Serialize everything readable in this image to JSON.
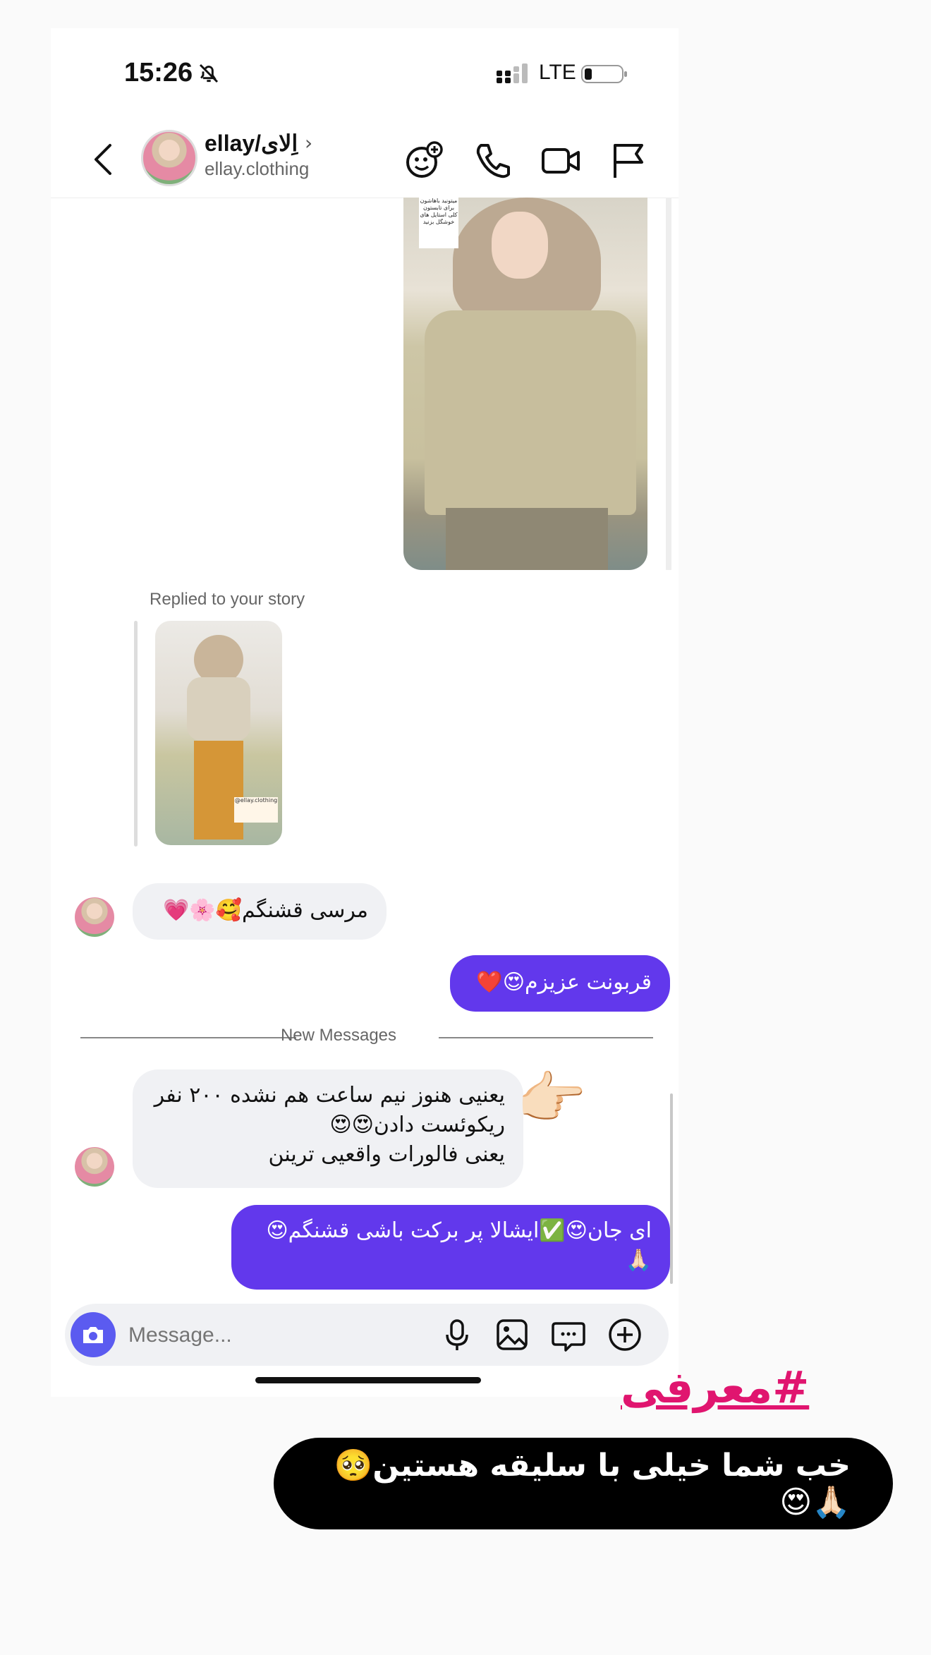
{
  "status_bar": {
    "time": "15:26",
    "network": "LTE"
  },
  "header": {
    "name": "ellay/اِلای",
    "username": "ellay.clothing"
  },
  "story_tag": "میتونید باهاشون برای تابستون کلی استایل های خوشگل بزنید",
  "replied_label": "Replied to your story",
  "thumb_label": "@ellay.clothing",
  "messages": [
    {
      "dir": "in",
      "text": "مرسی قشنگم🥰🌸💗"
    },
    {
      "dir": "out",
      "text": "قربونت عزیزم😍❤️"
    }
  ],
  "new_messages_label": "New Messages",
  "new_in_lines": [
    "یعنیی هنوز نیم ساعت هم نشده ۲۰۰ نفر",
    "ریکوئست دادن😍😍",
    "یعنی فالورات واقعیی ترینن"
  ],
  "pointing_emoji": "👉🏻",
  "out_long_lines": [
    "ای جان😍✅ایشالا پر برکت باشی قشنگم😍",
    "🙏🏻"
  ],
  "composer": {
    "placeholder": "Message..."
  },
  "overlay": {
    "hashtag": "#معرفی",
    "caption": "خب شما خیلی با سلیقه هستین🥺🙏🏻😍"
  },
  "colors": {
    "outgoing_bubble": "#6238ec",
    "incoming_bubble": "#f0f1f4",
    "hashtag": "#e0156f",
    "camera_button": "#5b5bf0"
  }
}
